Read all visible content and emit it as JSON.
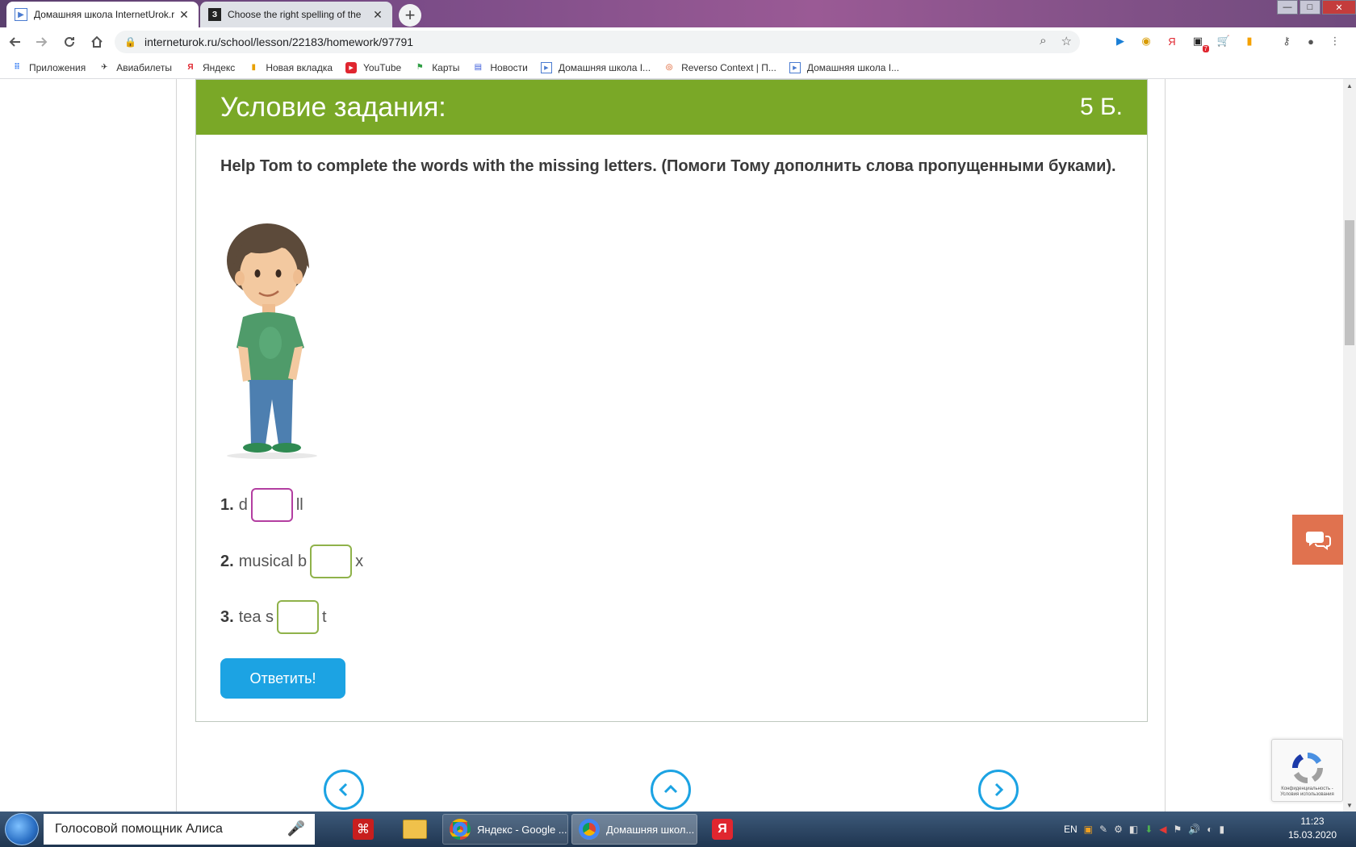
{
  "browser": {
    "tabs": [
      {
        "title": "Домашняя школа InternetUrok.r",
        "close": "✕"
      },
      {
        "title": "Choose the right spelling of the ",
        "close": "✕"
      }
    ],
    "new_tab": "+",
    "url": "interneturok.ru/school/lesson/22183/homework/97791",
    "window_controls": {
      "minimize": "—",
      "maximize": "□",
      "close": "✕"
    }
  },
  "bookmarks": [
    {
      "label": "Приложения",
      "icon": "apps-grid-icon"
    },
    {
      "label": "Авиабилеты",
      "icon": "plane-icon"
    },
    {
      "label": "Яндекс",
      "icon": "yandex-icon"
    },
    {
      "label": "Новая вкладка",
      "icon": "flag-icon"
    },
    {
      "label": "YouTube",
      "icon": "youtube-icon"
    },
    {
      "label": "Карты",
      "icon": "maps-icon"
    },
    {
      "label": "Новости",
      "icon": "news-icon"
    },
    {
      "label": "Домашняя школа I...",
      "icon": "interneturok-icon"
    },
    {
      "label": "Reverso Context | П...",
      "icon": "reverso-icon"
    },
    {
      "label": "Домашняя школа I...",
      "icon": "interneturok-icon"
    }
  ],
  "extensions": {
    "badge_count": "7"
  },
  "task": {
    "header_title": "Условие задания:",
    "points": "5 Б.",
    "instruction": "Help Tom to complete the words with the missing letters. (Помоги Тому дополнить слова пропущенными буками).",
    "questions": [
      {
        "num": "1.",
        "before": "d",
        "after": "ll",
        "value": ""
      },
      {
        "num": "2.",
        "before": "musical b",
        "after": "x",
        "value": ""
      },
      {
        "num": "3.",
        "before": "tea s",
        "after": "t",
        "value": ""
      }
    ],
    "submit_label": "Ответить!"
  },
  "recaptcha": {
    "text": "Конфиденциальность - Условия использования"
  },
  "taskbar": {
    "assistant": "Голосовой помощник Алиса",
    "windows": [
      {
        "label": "Яндекс - Google ..."
      },
      {
        "label": "Домашняя школ..."
      }
    ],
    "lang": "EN",
    "time": "11:23",
    "date": "15.03.2020"
  },
  "colors": {
    "header_green": "#7aa827",
    "submit_blue": "#1ca3e3",
    "chat_orange": "#e0724f",
    "focus_border": "#b33ea1",
    "input_border": "#8fb24a"
  }
}
